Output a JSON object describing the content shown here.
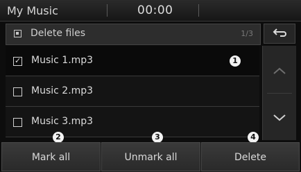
{
  "status_bar": {
    "title": "My Music",
    "clock": "00:00"
  },
  "header": {
    "title": "Delete files",
    "count": "1/3"
  },
  "list": {
    "items": [
      {
        "label": "Music 1.mp3",
        "checked": true
      },
      {
        "label": "Music 2.mp3",
        "checked": false
      },
      {
        "label": "Music 3.mp3",
        "checked": false
      }
    ]
  },
  "badges": {
    "one": "1",
    "two": "2",
    "three": "3",
    "four": "4"
  },
  "buttons": {
    "mark_all": "Mark all",
    "unmark_all": "Unmark all",
    "delete": "Delete"
  },
  "icons": {
    "back": "back-arrow-icon",
    "up": "chevron-up-icon",
    "down": "chevron-down-icon"
  },
  "colors": {
    "accent": "#0a0a0a",
    "text": "#dcdcdc"
  }
}
